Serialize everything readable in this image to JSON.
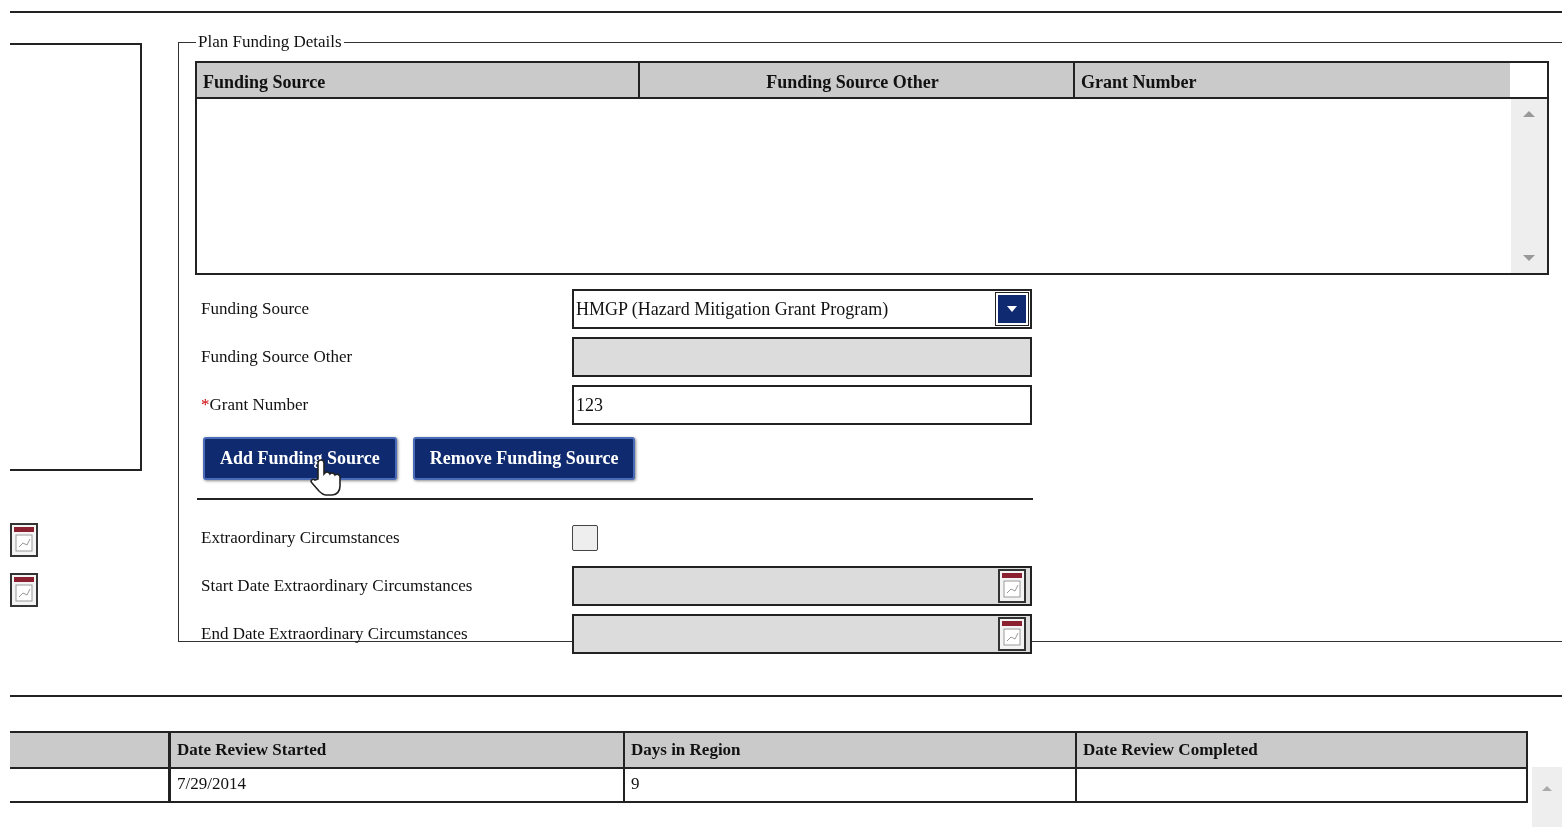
{
  "panel": {
    "legend": "Plan Funding Details",
    "table": {
      "columns": [
        "Funding Source",
        "Funding Source Other",
        "Grant Number"
      ]
    },
    "fields": [
      {
        "kind": "select",
        "label": "Funding Source",
        "value": "HMGP (Hazard Mitigation Grant Program)",
        "disabled": false
      },
      {
        "kind": "text",
        "label": "Funding Source Other",
        "disabled": true
      },
      {
        "kind": "text",
        "label": "Grant Number",
        "required_mark": "*",
        "value": "123",
        "disabled": false
      }
    ],
    "buttons": [
      "Add Funding Source",
      "Remove Funding Source"
    ],
    "extra_fields": [
      {
        "kind": "checkbox",
        "label": "Extraordinary Circumstances",
        "checked": false,
        "disabled": true
      },
      {
        "kind": "date",
        "label": "Start Date Extraordinary Circumstances",
        "disabled": true
      },
      {
        "kind": "date",
        "label": "End Date Extraordinary Circumstances",
        "disabled": true
      }
    ]
  },
  "review_table": {
    "columns": [
      "Date Review Started",
      "Days in Region",
      "Date Review Completed"
    ],
    "rows": [
      {
        "cells": [
          "7/29/2014",
          "9"
        ]
      }
    ]
  }
}
